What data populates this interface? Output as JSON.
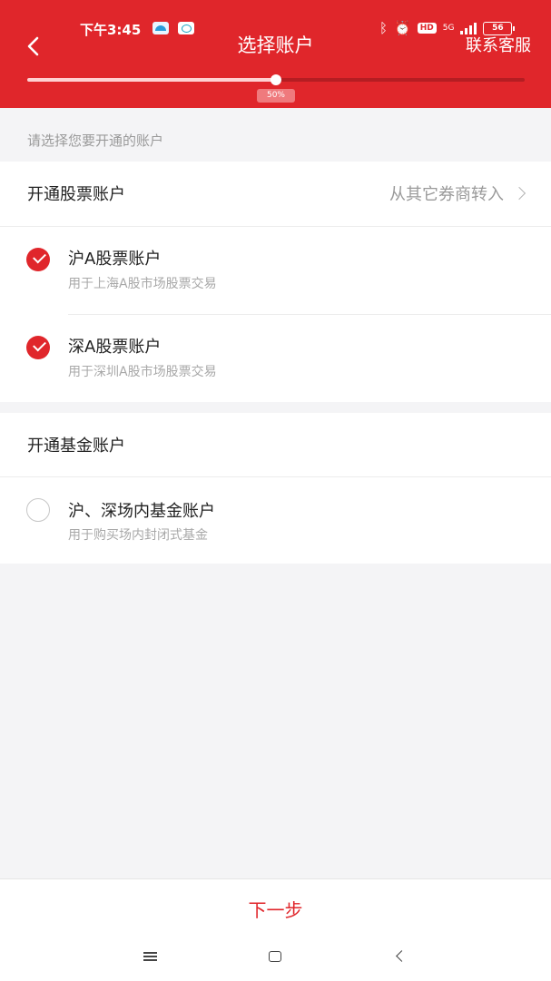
{
  "status_bar": {
    "time": "下午3:45",
    "network": "5G",
    "battery": "56"
  },
  "header": {
    "title": "选择账户",
    "contact_label": "联系客服"
  },
  "progress": {
    "value": 0.5,
    "label": "50%"
  },
  "hint": "请选择您要开通的账户",
  "stock_section": {
    "title": "开通股票账户",
    "transfer_label": "从其它券商转入",
    "options": [
      {
        "title": "沪A股票账户",
        "desc": "用于上海A股市场股票交易",
        "checked": true
      },
      {
        "title": "深A股票账户",
        "desc": "用于深圳A股市场股票交易",
        "checked": true
      }
    ]
  },
  "fund_section": {
    "title": "开通基金账户",
    "options": [
      {
        "title": "沪、深场内基金账户",
        "desc": "用于购买场内封闭式基金",
        "checked": false
      }
    ]
  },
  "footer": {
    "next_label": "下一步"
  },
  "colors": {
    "brand": "#e0262b",
    "muted_text": "#9a9a9a",
    "background": "#f4f4f6"
  }
}
